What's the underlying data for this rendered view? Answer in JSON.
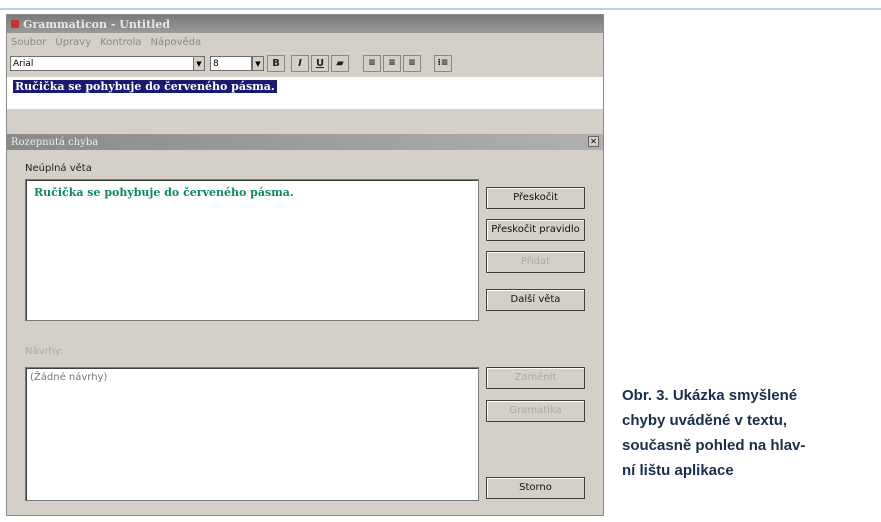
{
  "window": {
    "title": "Grammaticon - Untitled",
    "menu": [
      "Soubor",
      "Úpravy",
      "Kontrola",
      "Nápověda"
    ]
  },
  "toolbar": {
    "font_name": "Arial",
    "font_size": "8",
    "bold": "B",
    "italic": "I",
    "underline": "U"
  },
  "document": {
    "selected_sentence": "Ručička se pohybuje do červeného pásma."
  },
  "dialog": {
    "title": "Rozepnutá chyba",
    "incomplete_label": "Neúplná věta",
    "incomplete_sentence": "Ručička se pohybuje do červeného pásma.",
    "suggestions_label": "Návrhy:",
    "suggestions_text": "(Žádné návrhy)",
    "buttons": {
      "skip": "Přeskočit",
      "skip_rule": "Přeskočit pravidlo",
      "add": "Přidat",
      "next_sentence": "Další věta",
      "replace": "Zaměnit",
      "grammar": "Gramatika",
      "cancel": "Storno"
    }
  },
  "caption": {
    "lines": [
      "Obr. 3. Ukázka smyšlené",
      "chyby uváděné v textu,",
      "současně pohled na hlav-",
      "ní lištu aplikace"
    ]
  }
}
